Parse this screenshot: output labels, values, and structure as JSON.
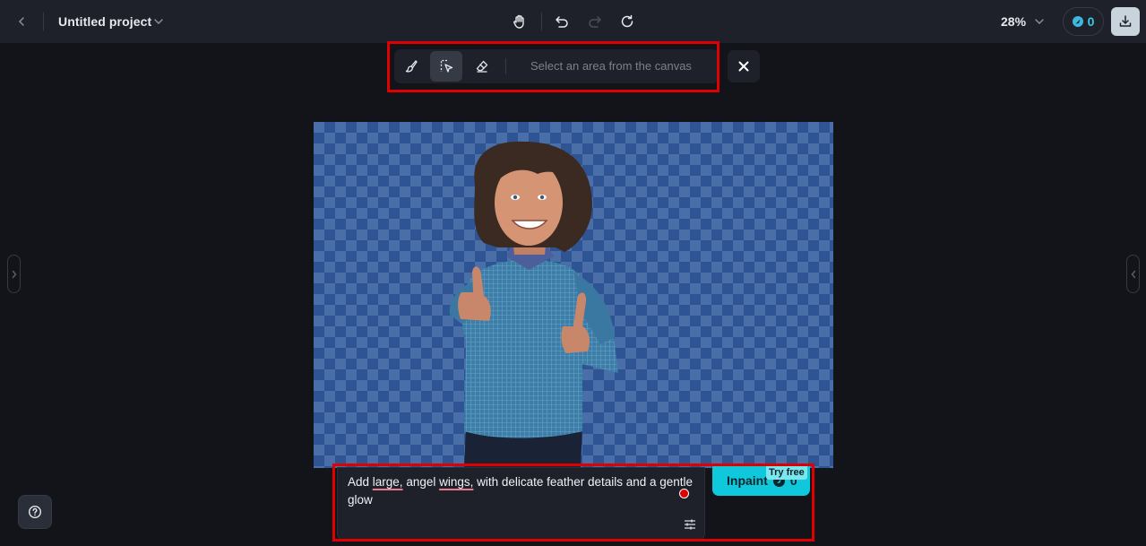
{
  "topbar": {
    "back_icon": "chevron-left-icon",
    "project_title": "Untitled project",
    "title_menu_icon": "chevron-down-icon",
    "tools": [
      {
        "name": "pan",
        "icon": "hand-icon",
        "enabled": true
      },
      {
        "name": "undo",
        "icon": "undo-icon",
        "enabled": true
      },
      {
        "name": "redo",
        "icon": "redo-icon",
        "enabled": false
      },
      {
        "name": "reset",
        "icon": "refresh-icon",
        "enabled": true
      }
    ],
    "zoom_level": "28%",
    "credits": "0",
    "download_icon": "download-icon"
  },
  "selection_toolbar": {
    "tools": [
      {
        "name": "brush",
        "icon": "brush-icon",
        "active": false
      },
      {
        "name": "smart-select",
        "icon": "select-area-icon",
        "active": true
      },
      {
        "name": "eraser",
        "icon": "eraser-icon",
        "active": false
      }
    ],
    "hint": "Select an area from the canvas",
    "close_icon": "close-icon"
  },
  "canvas": {
    "subject": "smiling boy with curly hair in blue checked shirt giving two thumbs up, transparent background"
  },
  "prompt": {
    "segments": [
      {
        "text": "Add ",
        "spell_error": false
      },
      {
        "text": "large,",
        "spell_error": true
      },
      {
        "text": " angel ",
        "spell_error": false
      },
      {
        "text": "wings,",
        "spell_error": true
      },
      {
        "text": " with delicate feather details and a gentle glow",
        "spell_error": false
      }
    ],
    "settings_icon": "sliders-icon"
  },
  "inpaint": {
    "label": "Inpaint",
    "cost": "0",
    "badge": "Try free"
  },
  "help_icon": "help-circle-icon",
  "colors": {
    "accent": "#0fc8dc",
    "highlight_outline": "#e00000",
    "background": "#131419",
    "panel": "#1e212a"
  }
}
